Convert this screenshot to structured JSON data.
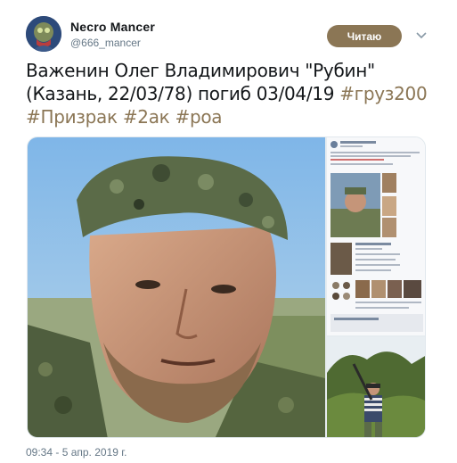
{
  "author": {
    "name": "Necro Mancer",
    "handle": "@666_mancer"
  },
  "follow_button": {
    "label": "Читаю"
  },
  "tweet": {
    "text_plain": "Важенин Олег Владимирович \"Рубин\" (Казань, 22/03/78) погиб 03/04/19 ",
    "hashtags": [
      "#груз200",
      "#Призрак",
      "#2ак",
      "#роа"
    ]
  },
  "timestamp": "09:34 - 5 апр. 2019 г.",
  "colors": {
    "accent": "#8b7655",
    "text": "#14171a",
    "secondary_text": "#657786"
  },
  "icons": {
    "caret": "chevron-down-icon",
    "avatar": "avatar-image"
  }
}
